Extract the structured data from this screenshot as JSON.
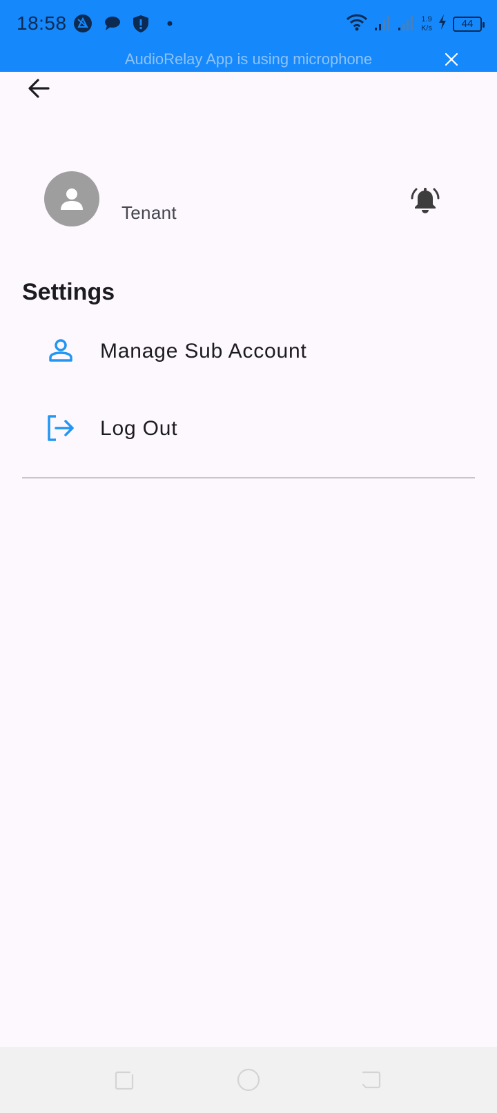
{
  "status_bar": {
    "time": "18:58",
    "net_speed_value": "1.9",
    "net_speed_unit": "K/s",
    "battery_level": "44"
  },
  "mic_banner": {
    "text": "AudioRelay App is using microphone"
  },
  "profile": {
    "role": "Tenant"
  },
  "settings": {
    "title": "Settings",
    "items": [
      {
        "label": "Manage Sub Account",
        "icon": "person-outline-icon"
      },
      {
        "label": "Log Out",
        "icon": "logout-icon"
      }
    ]
  },
  "colors": {
    "status_bar": "#1589fb",
    "accent": "#2196f3",
    "background": "#fdf8fd",
    "avatar": "#9e9e9e"
  }
}
